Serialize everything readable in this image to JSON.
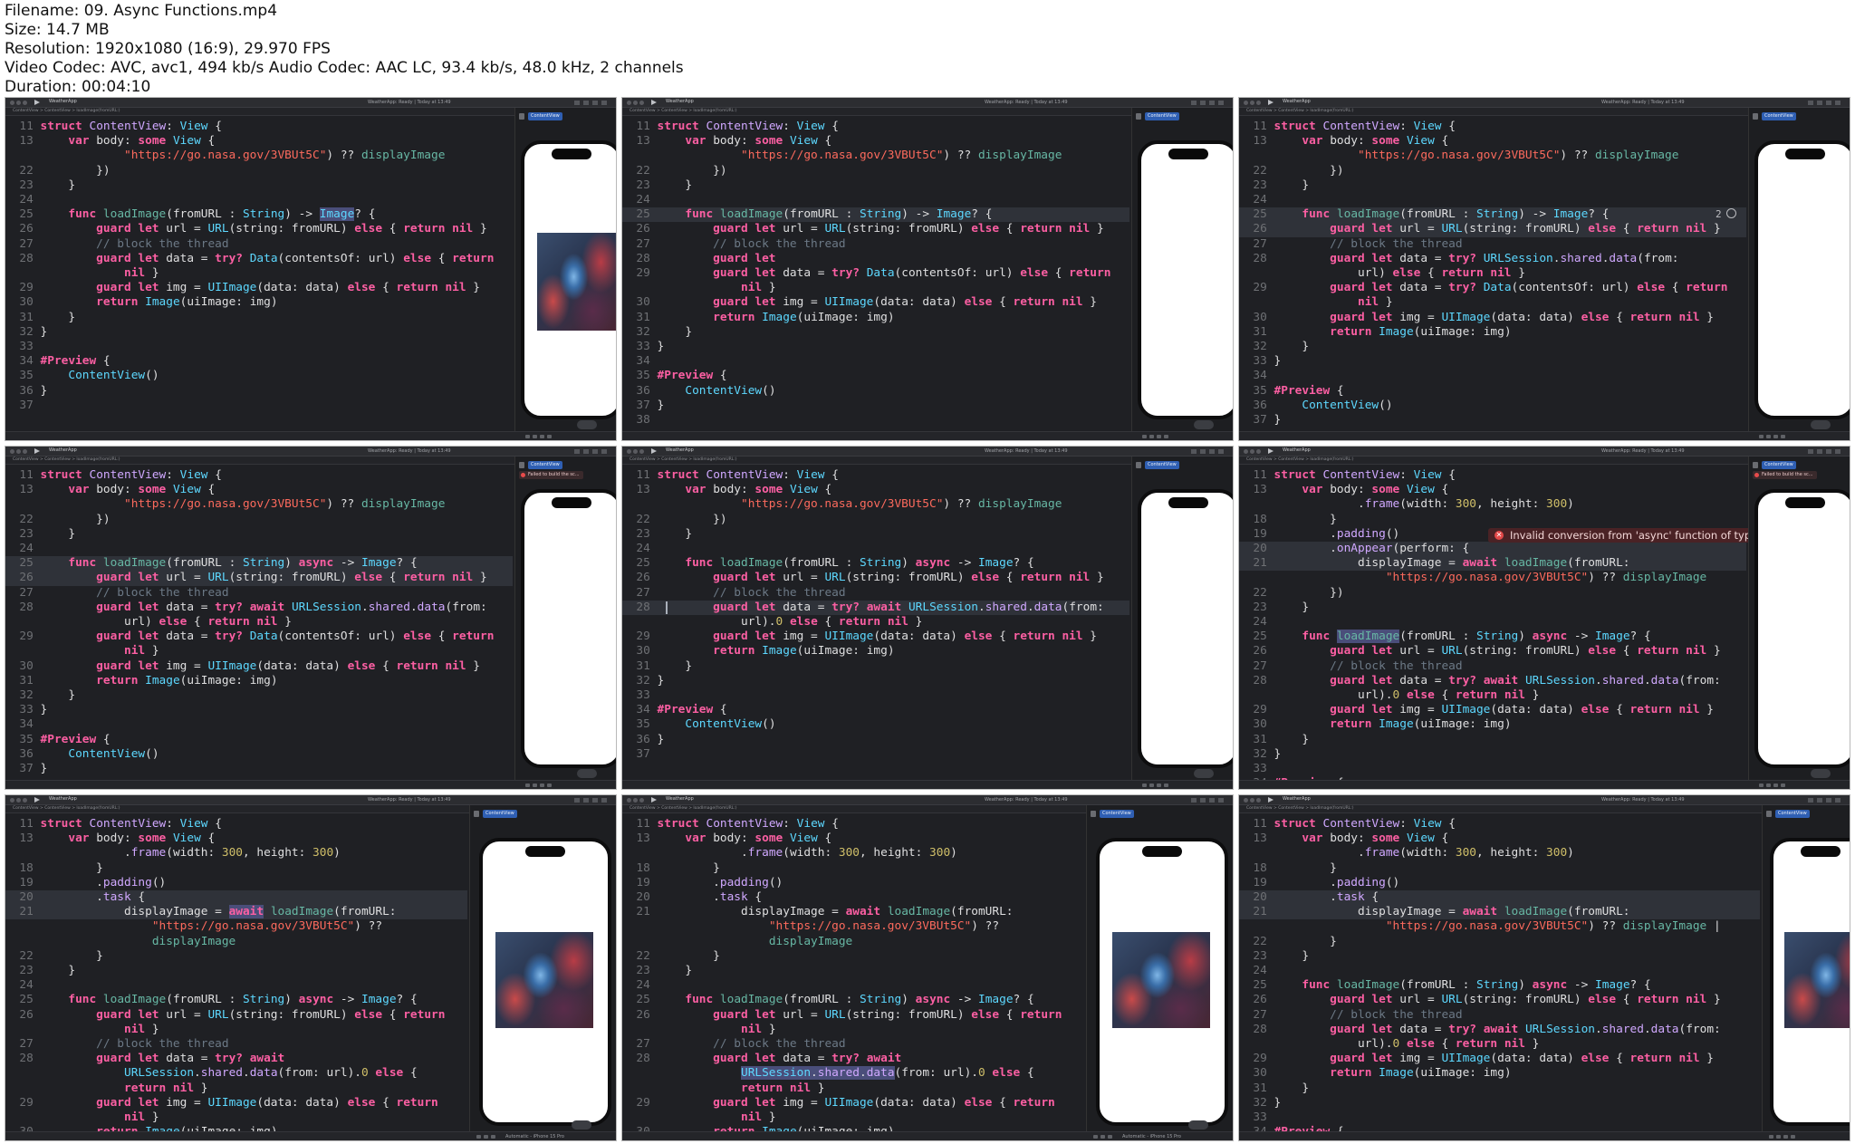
{
  "file_info": {
    "filename": "Filename: 09. Async Functions.mp4",
    "size": "Size: 14.7 MB",
    "resolution": "Resolution: 1920x1080 (16:9), 29.970 FPS",
    "codec": "Video Codec: AVC, avc1, 494 kb/s Audio Codec: AAC LC, 93.4 kb/s, 48.0 kHz, 2 channels",
    "duration": "Duration: 00:04:10"
  },
  "xcode": {
    "project_name": "WeatherApp",
    "status": "WeatherApp: Ready | Today at 13:49",
    "breadcrumb": "ContentView  >  ContentView  >  loadImage(fromURL:)",
    "preview_tab": "ContentView",
    "preview_error": "Failed to build the sc...",
    "device": "Automatic - iPhone 15 Pro"
  },
  "error_message": "Invalid conversion from 'async' function of type...",
  "warning_count": "2",
  "frames": [
    {
      "id": "t1",
      "current_line": null,
      "show_image": true,
      "show_error": false
    },
    {
      "id": "t2",
      "current_line": 6,
      "show_image": false,
      "show_error": false
    },
    {
      "id": "t3",
      "current_line": 6,
      "show_image": false,
      "show_error": false
    },
    {
      "id": "t4",
      "current_line": 8,
      "show_image": false,
      "show_error": true
    },
    {
      "id": "t5",
      "current_line": 11,
      "show_image": false,
      "show_error": false
    },
    {
      "id": "t6",
      "current_line": 5,
      "show_image": false,
      "show_error": true
    },
    {
      "id": "t7",
      "current_line": 4,
      "show_image": true,
      "show_error": false
    },
    {
      "id": "t8",
      "current_line": null,
      "show_image": true,
      "show_error": false
    },
    {
      "id": "t9",
      "current_line": 4,
      "show_image": true,
      "show_error": false
    }
  ]
}
